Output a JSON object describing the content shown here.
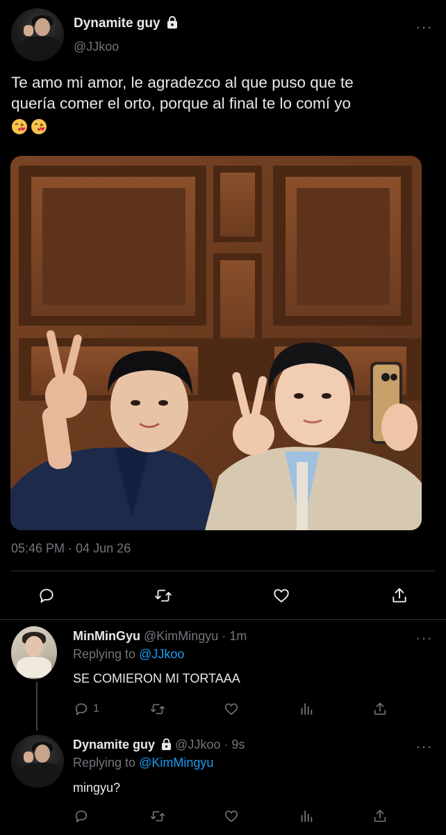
{
  "main_tweet": {
    "author_name": "Dynamite guy",
    "handle": "@JJkoo",
    "text_line1": "Te amo mi amor, le agradezco al que puso que te",
    "text_line2": "quería comer el orto, porque al final te lo comí yo",
    "timestamp": "05:46 PM · 04 Jun 26"
  },
  "replies": [
    {
      "author_name": "MinMinGyu",
      "handle": "@KimMingyu",
      "time": "· 1m",
      "replying_label": "Replying to",
      "replying_to": "@JJkoo",
      "text": "SE COMIERON MI TORTAAA",
      "reply_count": "1"
    },
    {
      "author_name": "Dynamite guy",
      "handle": "@JJkoo",
      "time": "· 9s",
      "replying_label": "Replying to",
      "replying_to": "@KimMingyu",
      "text": "mingyu?"
    }
  ],
  "icons": {
    "more": "more-icon",
    "lock": "lock-icon",
    "reply": "reply-icon",
    "retweet": "retweet-icon",
    "like": "heart-icon",
    "share": "share-icon",
    "views": "views-icon"
  },
  "colors": {
    "background": "#000000",
    "text": "#e7e9ea",
    "muted": "#71767b",
    "link": "#1d9bf0",
    "divider": "#2f3336"
  }
}
